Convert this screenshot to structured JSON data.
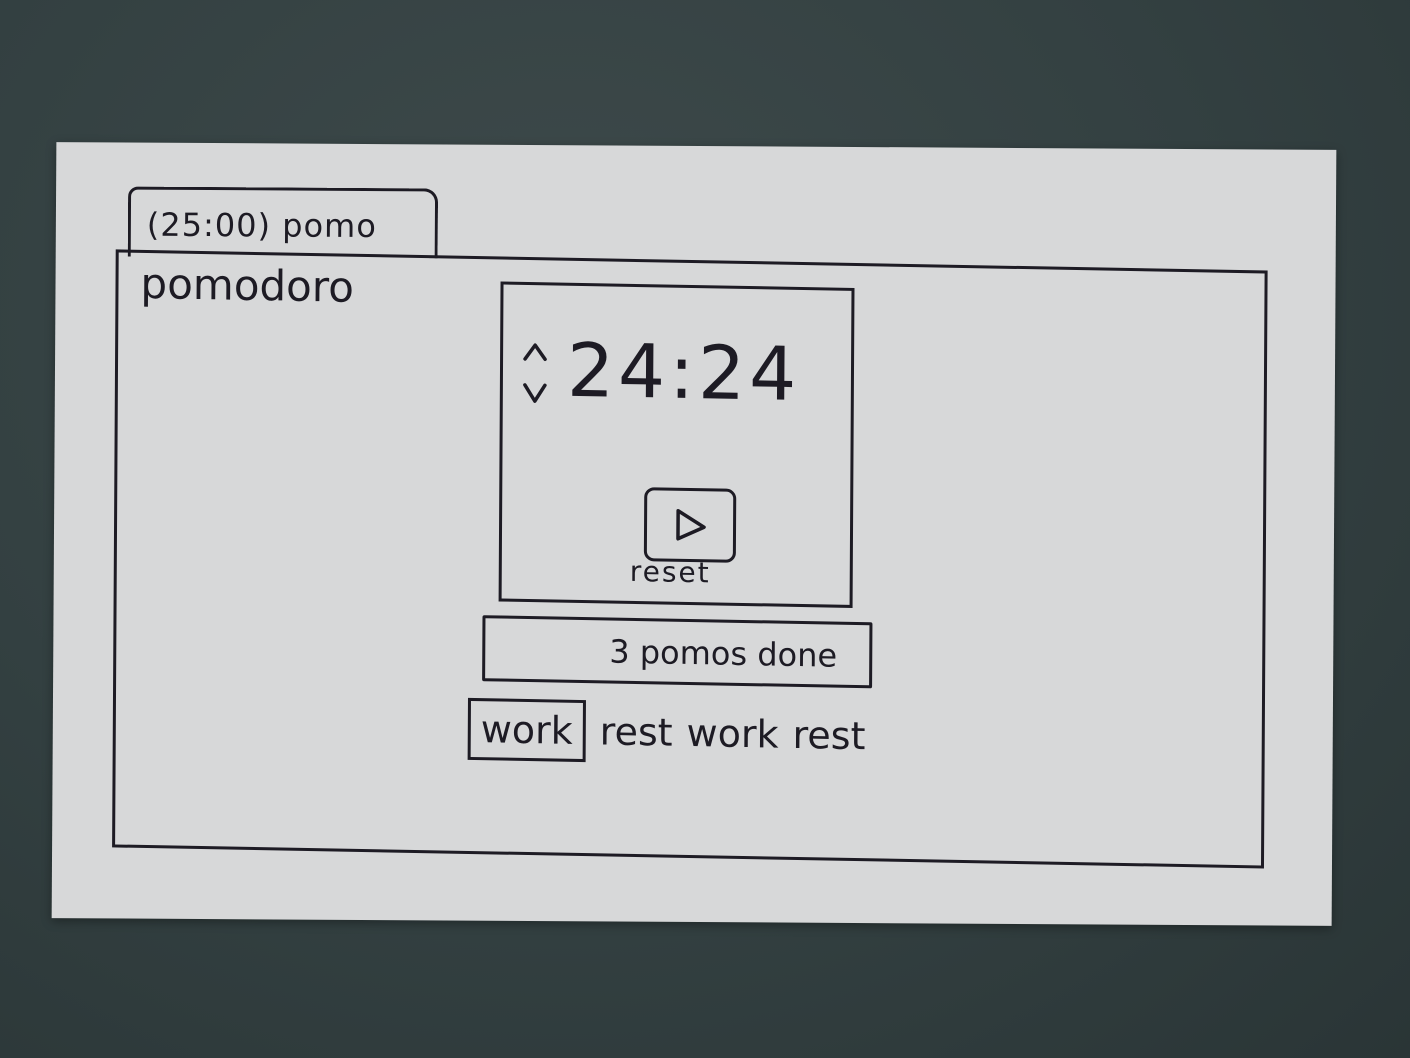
{
  "tab": {
    "label": "(25:00) pomo"
  },
  "app": {
    "title": "pomodoro"
  },
  "timer": {
    "value": "24:24",
    "reset_label": "reset"
  },
  "status": {
    "text": "3 pomos done"
  },
  "phases": [
    {
      "label": "work",
      "active": true
    },
    {
      "label": "rest",
      "active": false
    },
    {
      "label": "work",
      "active": false
    },
    {
      "label": "rest",
      "active": false
    }
  ],
  "colors": {
    "ink": "#1d1b24",
    "paper": "#d7d8d9",
    "background": "#334041"
  },
  "icons": {
    "stepper": "up-down-chevron-icon",
    "play": "play-icon"
  }
}
